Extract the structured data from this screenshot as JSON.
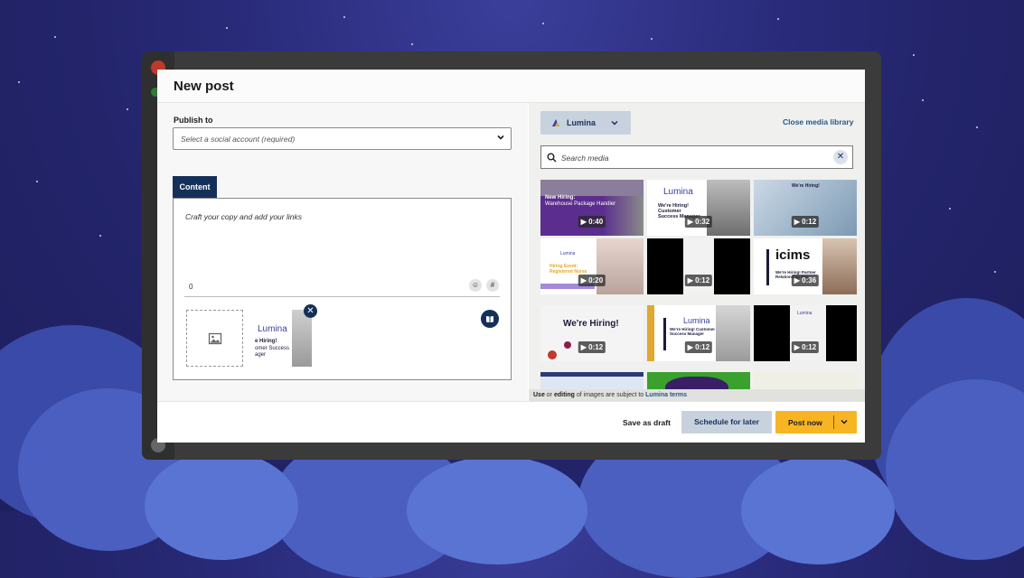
{
  "modal": {
    "title": "New post"
  },
  "publish": {
    "label": "Publish to",
    "placeholder": "Select a social account (required)"
  },
  "content": {
    "tab_label": "Content",
    "placeholder": "Craft your copy and add your links",
    "char_count": "0",
    "emoji_glyph": "☺",
    "hashtag_glyph": "#"
  },
  "attached_media": {
    "brand": "Lumina",
    "line1": "e Hiring!",
    "line2": "omer Success",
    "line3": "ager"
  },
  "library": {
    "selected": "Lumina",
    "close_label": "Close media library",
    "search_placeholder": "Search media",
    "tiles": [
      {
        "duration": "▶ 0:40",
        "title": "New Hiring:",
        "subtitle": "Warehouse Package Handler"
      },
      {
        "duration": "▶ 0:32",
        "title": "Lumina",
        "subtitle": "We're Hiring! Customer Success Manager"
      },
      {
        "duration": "▶ 0:12",
        "title": "We're Hiring!",
        "subtitle": ""
      },
      {
        "duration": "▶ 0:20",
        "title": "Lumina",
        "subtitle": "Hiring Event: Registered Nurse"
      },
      {
        "duration": "▶ 0:12",
        "title": "",
        "subtitle": ""
      },
      {
        "duration": "▶ 0:36",
        "title": "icims",
        "subtitle": "We're Hiring! Partner Relationship Mgr"
      },
      {
        "duration": "▶ 0:12",
        "title": "We're Hiring!",
        "subtitle": ""
      },
      {
        "duration": "▶ 0:12",
        "title": "Lumina",
        "subtitle": "We're Hiring! Customer Success Manager"
      },
      {
        "duration": "▶ 0:12",
        "title": "Lumina",
        "subtitle": ""
      }
    ],
    "terms_prefix": "Use",
    "terms_or": " or ",
    "terms_editing": "editing",
    "terms_middle": " of images are subject to ",
    "terms_link": "Lumina terms"
  },
  "footer": {
    "save_draft": "Save as draft",
    "schedule": "Schedule for later",
    "post_now": "Post now"
  },
  "colors": {
    "primary_navy": "#143059",
    "accent_yellow": "#f7b524",
    "link_blue": "#24588a"
  }
}
